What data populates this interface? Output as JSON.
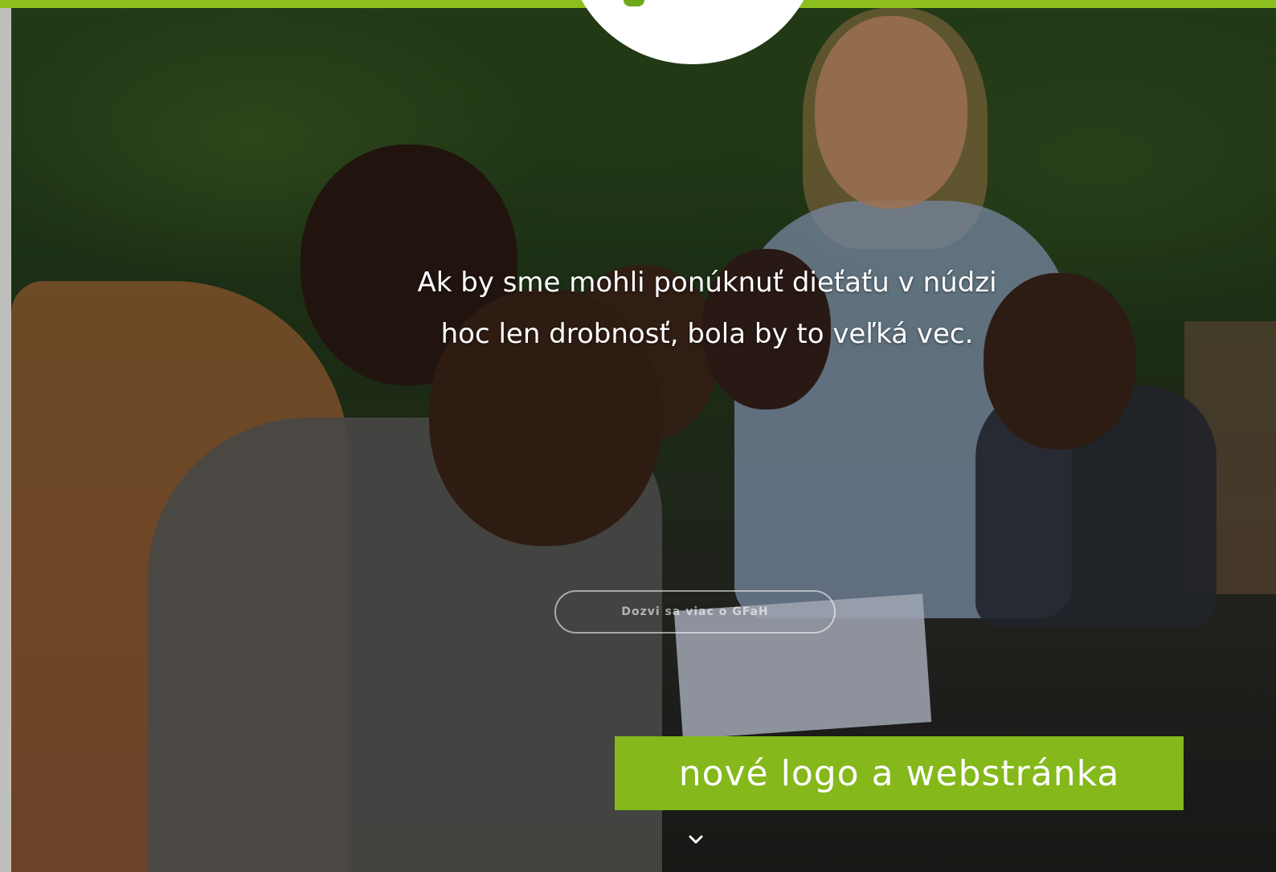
{
  "hero": {
    "headline_line1": "Ak by sme mohli ponúknuť dieťaťu v núdzi",
    "headline_line2": "hoc len drobnosť, bola by to veľká vec.",
    "more_button_label": "Dozvi sa viac o GFaH"
  },
  "banner": {
    "text": "nové logo a webstránka"
  },
  "icons": {
    "scroll_indicator": "chevron-down-icon",
    "logo": "leaf-logo-icon"
  },
  "colors": {
    "accent_green": "#84b81b",
    "top_bar_green": "#8bbe1e",
    "text_white": "#ffffff"
  }
}
